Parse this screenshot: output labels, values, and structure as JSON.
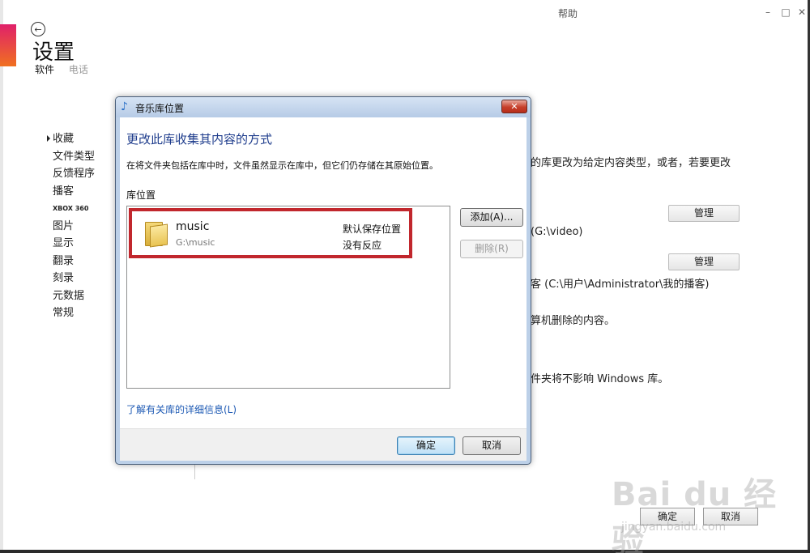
{
  "window": {
    "help_label": "帮助",
    "minimize_glyph": "–",
    "restore_glyph": "□",
    "close_glyph": "✕"
  },
  "header": {
    "title": "设置",
    "subnav": [
      "软件",
      "电话"
    ]
  },
  "sidebar": {
    "items": [
      "收藏",
      "文件类型",
      "反馈程序",
      "播客",
      "XBOX 360",
      "图片",
      "显示",
      "翻录",
      "刻录",
      "元数据",
      "常规"
    ]
  },
  "background": {
    "line1": "的库更改为给定内容类型，或者，若要更改",
    "manage_label": "管理",
    "line2": "(G:\\video)",
    "line3": "客 (C:\\用户\\Administrator\\我的播客)",
    "line4": "算机删除的内容。",
    "line5": "件夹将不影响 Windows 库。",
    "ok_label": "确定",
    "cancel_label": "取消"
  },
  "dialog": {
    "title": "音乐库位置",
    "heading": "更改此库收集其内容的方式",
    "description": "在将文件夹包括在库中时，文件虽然显示在库中，但它们仍存储在其原始位置。",
    "list_label": "库位置",
    "items": [
      {
        "name": "music",
        "path": "G:\\music",
        "status1": "默认保存位置",
        "status2": "没有反应"
      }
    ],
    "add_label": "添加(A)...",
    "remove_label": "删除(R)",
    "learn_link": "了解有关库的详细信息(L)",
    "ok_label": "确定",
    "cancel_label": "取消",
    "close_glyph": "✕"
  },
  "watermark": {
    "text": "Bai du 经验",
    "sub": "jingyan.baidu.com"
  },
  "colors": {
    "accent_top": "#e0206a",
    "accent_bottom": "#f07020",
    "highlight": "#c1272d",
    "link": "#1e5ab4",
    "heading": "#1e3c8c"
  }
}
